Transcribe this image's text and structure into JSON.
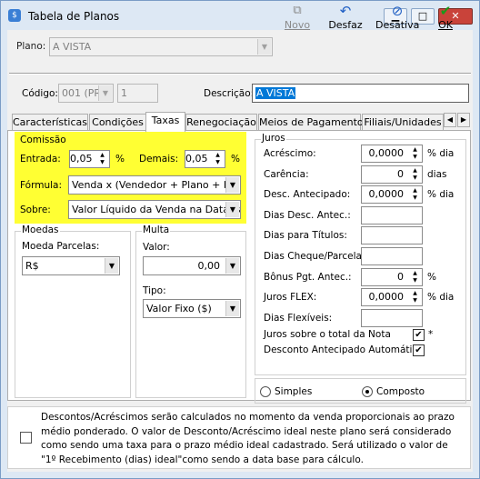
{
  "window": {
    "title": "Tabela de Planos",
    "min": "▁",
    "max": "□",
    "close": "✕"
  },
  "toolbar": {
    "plano_label": "Plano:",
    "plano_value": "A VISTA",
    "novo": "Novo",
    "desfaz": "Desfaz",
    "desativa": "Desativa",
    "ok": "OK"
  },
  "header": {
    "codigo_label": "Código:",
    "codigo_value": "001 (PR",
    "codigo_num": "1",
    "descricao_label": "Descrição:",
    "descricao_value": "A VISTA"
  },
  "tabs": [
    "Características",
    "Condições",
    "Taxas",
    "Renegociação",
    "Meios de Pagamento",
    "Filiais/Unidades"
  ],
  "comissao": {
    "title": "Comissão",
    "entrada_label": "Entrada:",
    "entrada_value": "0,05",
    "entrada_unit": "%",
    "demais_label": "Demais:",
    "demais_value": "0,05",
    "demais_unit": "%",
    "formula_label": "Fórmula:",
    "formula_value": "Venda x (Vendedor + Plano + Produ",
    "sobre_label": "Sobre:",
    "sobre_value": "Valor Líquido da Venda na Data da"
  },
  "moedas": {
    "title": "Moedas",
    "parcelas_label": "Moeda Parcelas:",
    "parcelas_value": "R$"
  },
  "multa": {
    "title": "Multa",
    "valor_label": "Valor:",
    "valor_value": "0,00",
    "tipo_label": "Tipo:",
    "tipo_value": "Valor Fixo ($)"
  },
  "juros": {
    "title": "Juros",
    "rows": [
      {
        "label": "Acréscimo:",
        "value": "0,0000",
        "unit": "% dia"
      },
      {
        "label": "Carência:",
        "value": "0",
        "unit": "dias"
      },
      {
        "label": "Desc. Antecipado:",
        "value": "0,0000",
        "unit": "% dia"
      },
      {
        "label": "Dias Desc. Antec.:",
        "value": "",
        "unit": ""
      },
      {
        "label": "Dias para Títulos:",
        "value": "",
        "unit": ""
      },
      {
        "label": "Dias Cheque/Parcela",
        "value": "",
        "unit": ""
      },
      {
        "label": "Bônus Pgt. Antec.:",
        "value": "0",
        "unit": "%"
      },
      {
        "label": "Juros FLEX:",
        "value": "0,0000",
        "unit": "% dia"
      },
      {
        "label": "Dias Flexíveis:",
        "value": "",
        "unit": ""
      }
    ],
    "juros_nota_label": "Juros sobre o total da Nota",
    "juros_nota_star": "*",
    "desconto_auto_label": "Desconto Antecipado Automático",
    "simples_label": "Simples",
    "composto_label": "Composto"
  },
  "note": {
    "text": "Descontos/Acréscimos serão calculados no momento da venda proporcionais ao prazo médio ponderado. O valor de Desconto/Acréscimo ideal neste plano será considerado como sendo uma taxa para o prazo médio ideal cadastrado. Será utilizado o valor de \"1º Recebimento (dias) ideal\"como sendo a data base para cálculo."
  },
  "colors": {
    "highlight": "#ffff33",
    "selection": "#0078d7",
    "accent": "#1f5fc4"
  }
}
